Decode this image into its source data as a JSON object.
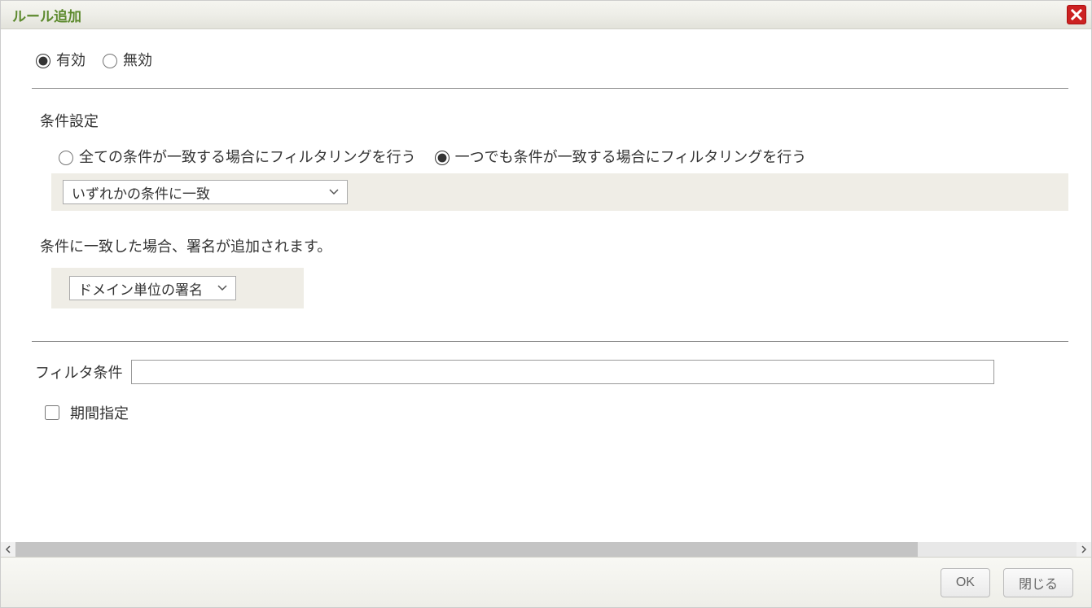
{
  "dialog": {
    "title": "ルール追加"
  },
  "status": {
    "enabled_label": "有効",
    "disabled_label": "無効",
    "selected": "enabled"
  },
  "condition_settings": {
    "heading": "条件設定",
    "match_all_label": "全ての条件が一致する場合にフィルタリングを行う",
    "match_any_label": "一つでも条件が一致する場合にフィルタリングを行う",
    "selected": "any",
    "condition_select_value": "いずれかの条件に一致"
  },
  "signature_note": "条件に一致した場合、署名が追加されます。",
  "signature_select_value": "ドメイン単位の署名",
  "filter": {
    "label": "フィルタ条件",
    "value": ""
  },
  "period": {
    "label": "期間指定",
    "checked": false
  },
  "footer": {
    "ok": "OK",
    "close": "閉じる"
  }
}
